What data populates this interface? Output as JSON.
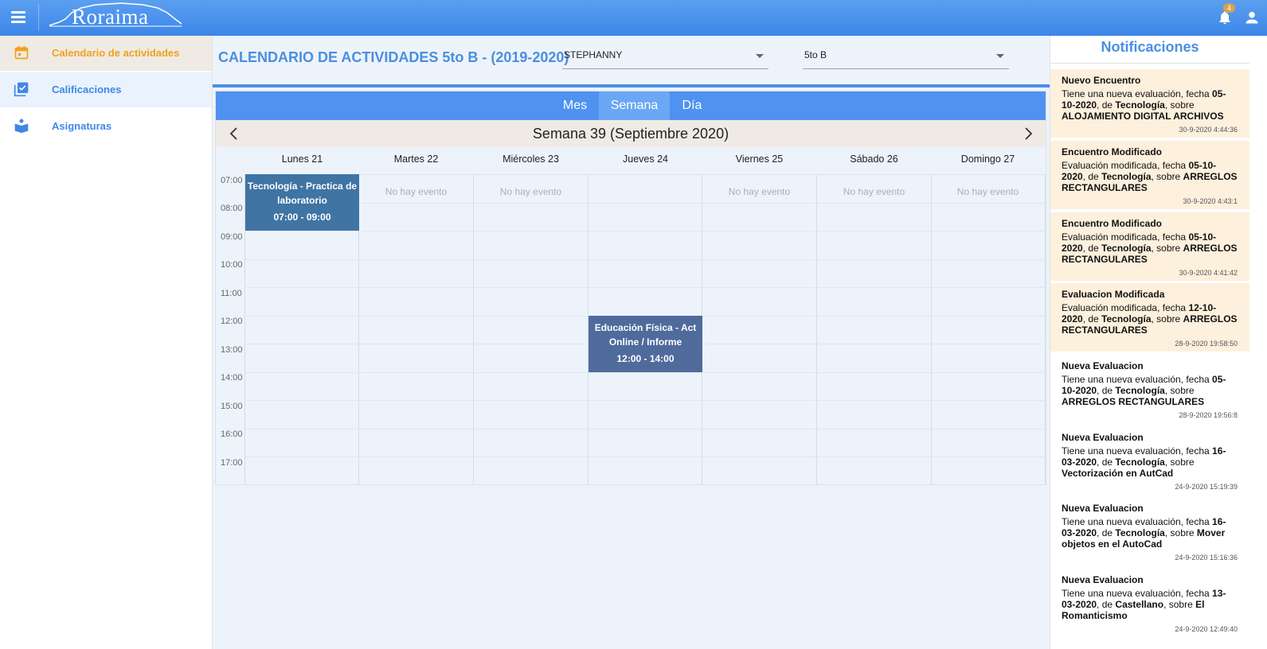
{
  "topbar": {
    "logo_text": "Roraima",
    "notification_count": "4"
  },
  "sidebar": {
    "items": [
      {
        "label": "Calendario de actividades",
        "icon": "calendar-icon"
      },
      {
        "label": "Calificaciones",
        "icon": "grades-check-icon"
      },
      {
        "label": "Asignaturas",
        "icon": "reader-book-icon"
      }
    ]
  },
  "main": {
    "title": "CALENDARIO DE ACTIVIDADES 5to B - (2019-2020)",
    "student_select": "STEPHANNY",
    "section_select": "5to B"
  },
  "calendar": {
    "views": [
      "Mes",
      "Semana",
      "Día"
    ],
    "active_view": "Semana",
    "week_title": "Semana 39 (Septiembre 2020)",
    "days": [
      "Lunes 21",
      "Martes 22",
      "Miércoles 23",
      "Jueves 24",
      "Viernes 25",
      "Sábado 26",
      "Domingo 27"
    ],
    "hours": [
      "07:00",
      "08:00",
      "09:00",
      "10:00",
      "11:00",
      "12:00",
      "13:00",
      "14:00",
      "15:00",
      "16:00",
      "17:00"
    ],
    "no_event_text": "No hay evento",
    "events": [
      {
        "title": "Tecnología - Practica de laboratorio",
        "time": "07:00 - 09:00",
        "color": "#3f74a3"
      },
      {
        "title": "Educación Física - Act Online / Informe",
        "time": "12:00 - 14:00",
        "color": "#4f6b9c"
      }
    ]
  },
  "notifications": {
    "title": "Notificaciones",
    "items": [
      {
        "title": "Nuevo Encuentro",
        "prefix": "Tiene una nueva evaluación, fecha ",
        "date": "05-10-2020",
        "mid": ", de ",
        "subject": "Tecnología",
        "mid2": ", sobre ",
        "topic": "ALOJAMIENTO DIGITAL ARCHIVOS",
        "timestamp": "30-9-2020 4:44:36"
      },
      {
        "title": "Encuentro Modificado",
        "prefix": "Evaluación modificada, fecha ",
        "date": "05-10-2020",
        "mid": ", de ",
        "subject": "Tecnología",
        "mid2": ", sobre ",
        "topic": "ARREGLOS RECTANGULARES",
        "timestamp": "30-9-2020 4:43:1"
      },
      {
        "title": "Encuentro Modificado",
        "prefix": "Evaluación modificada, fecha ",
        "date": "05-10-2020",
        "mid": ", de ",
        "subject": "Tecnología",
        "mid2": ", sobre ",
        "topic": "ARREGLOS RECTANGULARES",
        "timestamp": "30-9-2020 4:41:42"
      },
      {
        "title": "Evaluacion Modificada",
        "prefix": "Evaluación modificada, fecha ",
        "date": "12-10-2020",
        "mid": ", de ",
        "subject": "Tecnología",
        "mid2": ", sobre ",
        "topic": "ARREGLOS RECTANGULARES",
        "timestamp": "28-9-2020 19:58:50"
      },
      {
        "title": "Nueva Evaluacion",
        "prefix": "Tiene una nueva evaluación, fecha ",
        "date": "05-10-2020",
        "mid": ", de ",
        "subject": "Tecnología",
        "mid2": ", sobre ",
        "topic": "ARREGLOS RECTANGULARES",
        "timestamp": "28-9-2020 19:56:8"
      },
      {
        "title": "Nueva Evaluacion",
        "prefix": "Tiene una nueva evaluación, fecha ",
        "date": "16-03-2020",
        "mid": ", de ",
        "subject": "Tecnología",
        "mid2": ", sobre ",
        "topic": "Vectorización en AutCad",
        "timestamp": "24-9-2020 15:19:39"
      },
      {
        "title": "Nueva Evaluacion",
        "prefix": "Tiene una nueva evaluación, fecha ",
        "date": "16-03-2020",
        "mid": ", de ",
        "subject": "Tecnología",
        "mid2": ", sobre ",
        "topic": "Mover objetos en el AutoCad",
        "timestamp": "24-9-2020 15:16:36"
      },
      {
        "title": "Nueva Evaluacion",
        "prefix": "Tiene una nueva evaluación, fecha ",
        "date": "13-03-2020",
        "mid": ", de ",
        "subject": "Castellano",
        "mid2": ", sobre ",
        "topic": "El Romanticismo",
        "timestamp": "24-9-2020 12:49:40"
      }
    ]
  }
}
